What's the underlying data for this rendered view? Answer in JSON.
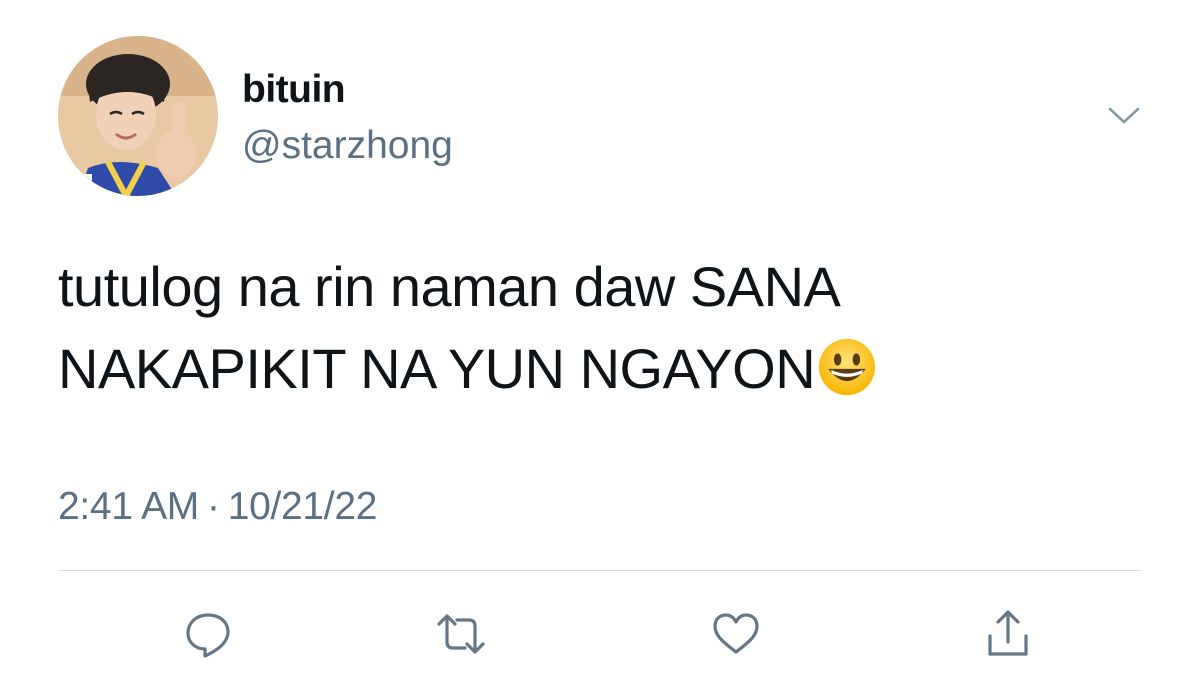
{
  "tweet": {
    "author": {
      "display_name": "bituin",
      "handle": "@starzhong",
      "avatar_icon": "profile-photo"
    },
    "text": {
      "line1": "tutulog na rin naman daw SANA",
      "line2": "NAKAPIKIT NA YUN NGAYON",
      "emoji": "grinning-face-icon"
    },
    "time": "2:41 AM",
    "separator": "·",
    "date": "10/21/22"
  },
  "actions": [
    {
      "name": "reply",
      "icon": "reply-icon"
    },
    {
      "name": "retweet",
      "icon": "retweet-icon"
    },
    {
      "name": "like",
      "icon": "heart-icon"
    },
    {
      "name": "share",
      "icon": "share-icon"
    }
  ],
  "colors": {
    "text_primary": "#0f1419",
    "text_secondary": "#5b7083",
    "icon": "#657786",
    "divider": "#d6dde3"
  }
}
